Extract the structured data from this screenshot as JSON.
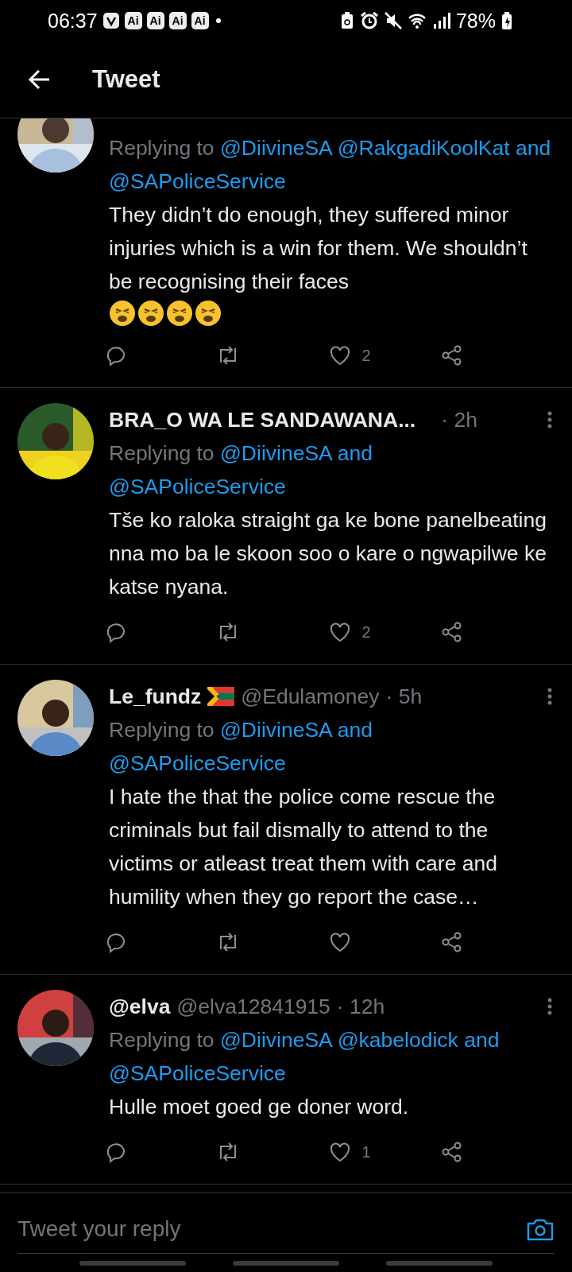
{
  "status_bar": {
    "time": "06:37",
    "notification_icons": [
      {
        "kind": "logo"
      },
      {
        "kind": "label",
        "label": "Ai"
      },
      {
        "kind": "label",
        "label": "Ai"
      },
      {
        "kind": "label",
        "label": "Ai"
      },
      {
        "kind": "label",
        "label": "Ai"
      },
      {
        "kind": "dot"
      }
    ],
    "system_icons": [
      {
        "kind": "battery-saver"
      },
      {
        "kind": "alarm"
      },
      {
        "kind": "mute"
      },
      {
        "kind": "wifi"
      },
      {
        "kind": "signal"
      }
    ],
    "battery": "78%"
  },
  "header": {
    "title": "Tweet"
  },
  "tweets": [
    {
      "replying_to": {
        "prefix": "Replying to",
        "mentions": [
          "@DiivineSA",
          "@RakgadiKoolKat",
          "@SAPoliceService"
        ],
        "conjunction": "and"
      },
      "body": "They didn’t do enough, they suffered minor injuries which is a win for them. We shouldn’t be recognising their faces",
      "reactions": [
        {
          "kind": "tired-face"
        },
        {
          "kind": "tired-face"
        },
        {
          "kind": "tired-face"
        },
        {
          "kind": "tired-face"
        }
      ],
      "like_count": "2"
    },
    {
      "name": "BRA_O WA LE SANDAWANA...",
      "time": "· 2h",
      "replying_to": {
        "prefix": "Replying to",
        "mentions": [
          "@DiivineSA",
          "@SAPoliceService"
        ],
        "conjunction": "and"
      },
      "body": "Tše ko raloka straight ga ke bone panelbeating nna mo ba le skoon soo o kare o ngwapilwe ke katse nyana.",
      "like_count": "2"
    },
    {
      "name": "Le_fundz",
      "badges": [
        {
          "kind": "flag-za"
        }
      ],
      "handle": "@Edulamoney",
      "time": "· 5h",
      "replying_to": {
        "prefix": "Replying to",
        "mentions": [
          "@DiivineSA",
          "@SAPoliceService"
        ],
        "conjunction": "and"
      },
      "body": "I hate the that the police come rescue the criminals but fail dismally to attend to the victims or atleast treat them with care and humility when they go report the case…"
    },
    {
      "name": "@elva",
      "handle": "@elva12841915",
      "time": "· 12h",
      "replying_to": {
        "prefix": "Replying to",
        "mentions": [
          "@DiivineSA",
          "@kabelodick",
          "@SAPoliceService"
        ],
        "conjunction": "and"
      },
      "body": "Hulle moet goed ge doner word.",
      "like_count": "1"
    }
  ],
  "reply_bar": {
    "placeholder": "Tweet your reply"
  }
}
